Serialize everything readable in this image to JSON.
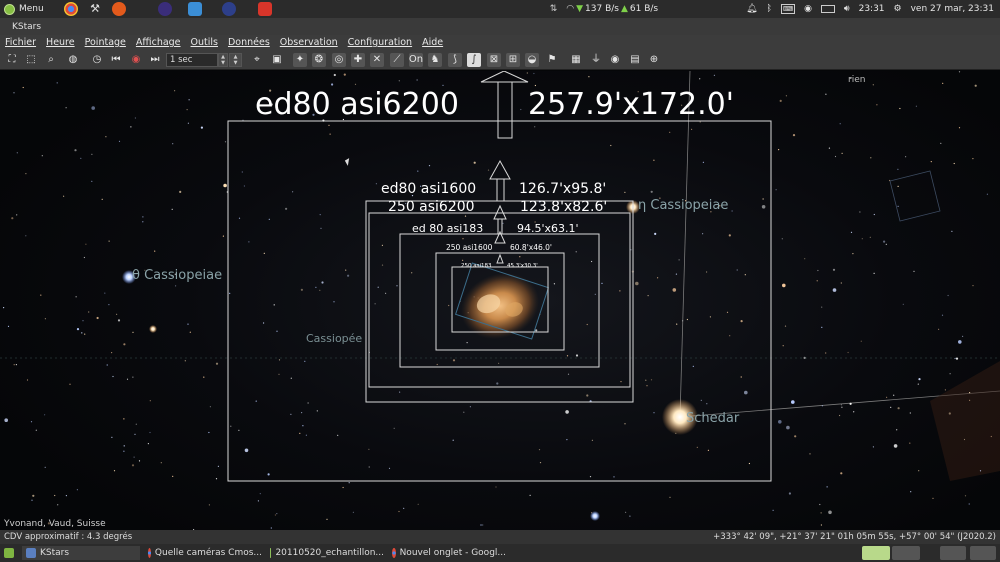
{
  "top_panel": {
    "menu_label": "Menu",
    "network_up": "137 B/s",
    "network_down": "61 B/s",
    "time": "23:31",
    "date": "ven 27 mar, 23:31"
  },
  "window": {
    "title": "KStars"
  },
  "menu": {
    "items": [
      "Fichier",
      "Heure",
      "Pointage",
      "Affichage",
      "Outils",
      "Données",
      "Observation",
      "Configuration",
      "Aide"
    ]
  },
  "toolbar": {
    "time_step": "1 sec"
  },
  "sky": {
    "corner_label": "rien",
    "fov": [
      {
        "name": "ed80 asi6200",
        "size": "257.9'x172.0'"
      },
      {
        "name": "ed80 asi1600",
        "size": "126.7'x95.8'"
      },
      {
        "name": "250 asi6200",
        "size": "123.8'x82.6'"
      },
      {
        "name": "ed 80 asi183",
        "size": "94.5'x63.1'"
      },
      {
        "name": "250 asi1600",
        "size": "60.8'x46.0'"
      },
      {
        "name": "250 asi183",
        "size": "45.3'x30.3'"
      }
    ],
    "stars": {
      "eta": "η Cassiopeiae",
      "theta": "θ Cassiopeiae",
      "schedar": "Schedar"
    },
    "constellation": "Cassiopée"
  },
  "location": "Yvonand, Vaud, Suisse",
  "status": {
    "fov": "CDV approximatif : 4.3 degrés",
    "coords": "+333° 42' 09\", +21° 37' 21\"  01h 05m 55s, +57° 00' 54\" (J2020.2)"
  },
  "taskbar": {
    "items": [
      "KStars",
      "Quelle caméras Cmos...",
      "20110520_echantillon...",
      "Nouvel onglet - Googl..."
    ]
  },
  "colors": {
    "fov_frame": "#d9d9d9",
    "star_label": "#8aa3a8",
    "nebula": "#c98a4b",
    "tray_green": "#7fd14a"
  }
}
